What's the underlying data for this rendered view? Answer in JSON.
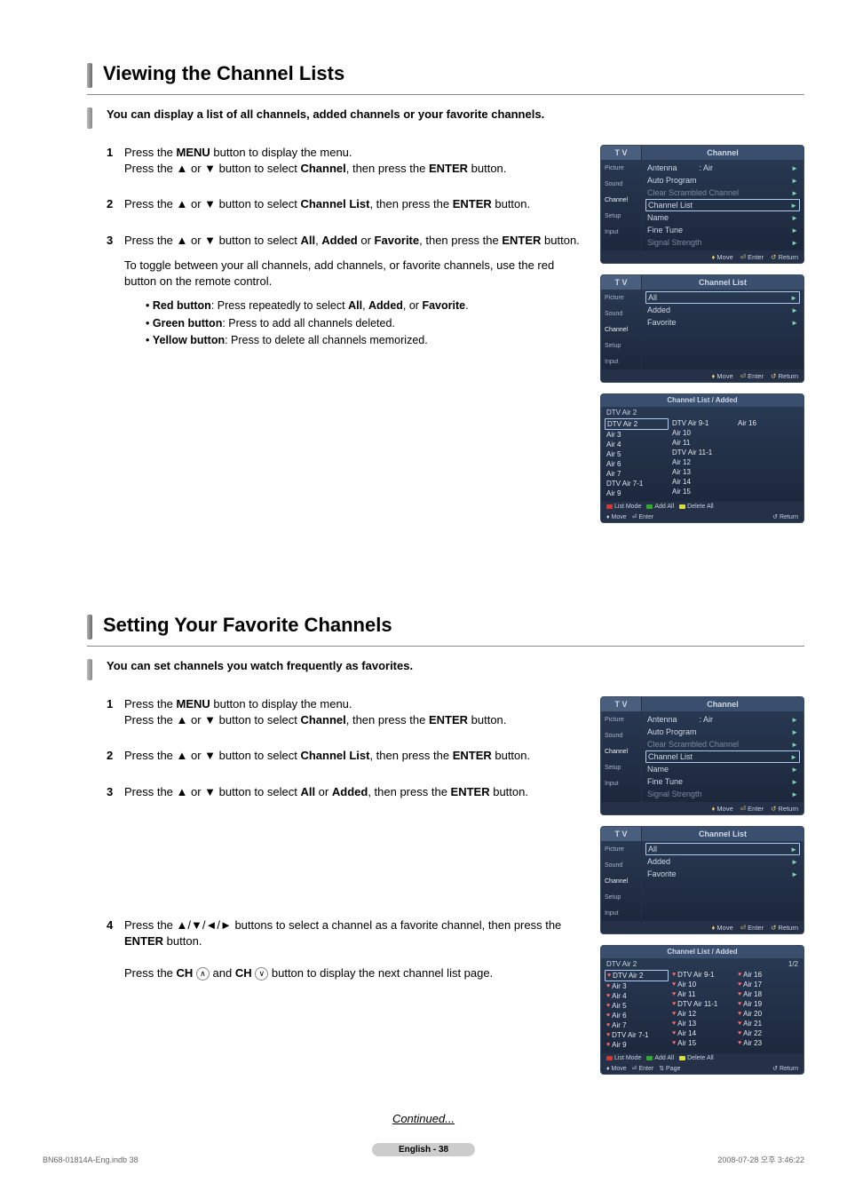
{
  "section1": {
    "title": "Viewing the Channel Lists",
    "intro": "You can display a list of all channels, added channels or your favorite channels.",
    "steps": {
      "s1a": "Press the ",
      "s1b": "MENU",
      "s1c": " button to display the menu.",
      "s1d": "Press the ▲ or ▼ button to select ",
      "s1e": "Channel",
      "s1f": ", then press the ",
      "s1g": "ENTER",
      "s1h": " button.",
      "s2a": "Press the ▲ or ▼ button to select ",
      "s2b": "Channel List",
      "s2c": ", then press the ",
      "s2d": "ENTER",
      "s2e": " button.",
      "s3a": "Press the ▲ or ▼ button to select ",
      "s3b": "All",
      "s3c": ", ",
      "s3d": "Added",
      "s3e": " or ",
      "s3f": "Favorite",
      "s3g": ", then press the ",
      "s3h": "ENTER",
      "s3i": " button.",
      "s3j": "To toggle between your all channels, add channels, or favorite channels, use the red button on the remote control.",
      "b1a": "Red button",
      "b1b": ": Press repeatedly to select ",
      "b1c": "All",
      "b1d": ", ",
      "b1e": "Added",
      "b1f": ", or ",
      "b1g": "Favorite",
      "b1h": ".",
      "b2a": "Green button",
      "b2b": ": Press to add all channels deleted.",
      "b3a": "Yellow button",
      "b3b": ": Press to delete all channels memorized."
    }
  },
  "section2": {
    "title": "Setting Your Favorite Channels",
    "intro": "You can set channels you watch frequently as favorites.",
    "steps": {
      "s1a": "Press the ",
      "s1b": "MENU",
      "s1c": " button to display the menu.",
      "s1d": "Press the ▲ or ▼ button to select ",
      "s1e": "Channel",
      "s1f": ", then press the ",
      "s1g": "ENTER",
      "s1h": " button.",
      "s2a": "Press the ▲ or ▼ button to select ",
      "s2b": "Channel List",
      "s2c": ", then press the ",
      "s2d": "ENTER",
      "s2e": " button.",
      "s3a": "Press the ▲ or ▼ button to select ",
      "s3b": "All",
      "s3c": " or ",
      "s3d": "Added",
      "s3e": ", then press the ",
      "s3f": "ENTER",
      "s3g": " button.",
      "s4a": "Press the ▲/▼/◄/► buttons to select a channel as a favorite channel, then press the ",
      "s4b": "ENTER",
      "s4c": " button.",
      "s4d": "Press the ",
      "s4e": "CH",
      "s4f": " and ",
      "s4g": "CH",
      "s4h": " button to display the next channel list page."
    }
  },
  "osd": {
    "tv": "T V",
    "channel_hd": "Channel",
    "chlist_hd": "Channel List",
    "side": {
      "picture": "Picture",
      "sound": "Sound",
      "channel": "Channel",
      "setup": "Setup",
      "input": "Input"
    },
    "menu": {
      "antenna": "Antenna",
      "antenna_val": ": Air",
      "auto": "Auto Program",
      "clear": "Clear Scrambled Channel",
      "chlist": "Channel List",
      "name": "Name",
      "fine": "Fine Tune",
      "signal": "Signal Strength"
    },
    "chlist_menu": {
      "all": "All",
      "added": "Added",
      "fav": "Favorite"
    },
    "foot": {
      "move": "Move",
      "enter": "Enter",
      "return": "Return",
      "page": "Page"
    },
    "listfoot": {
      "mode": "List Mode",
      "addall": "Add All",
      "delall": "Delete All"
    },
    "listhead": "Channel List / Added",
    "listsub": "DTV Air 2",
    "pager": "1/2",
    "ch1": {
      "col1": [
        "DTV Air 2",
        "Air 3",
        "Air 4",
        "Air 5",
        "Air 6",
        "Air 7",
        "DTV Air 7-1",
        "Air 9"
      ],
      "col2": [
        "DTV Air 9-1",
        "Air 10",
        "Air 11",
        "DTV Air 11-1",
        "Air 12",
        "Air 13",
        "Air 14",
        "Air 15"
      ],
      "col3": [
        "Air 16",
        "",
        "",
        "",
        "",
        "",
        "",
        ""
      ]
    },
    "ch2": {
      "col1": [
        "DTV Air 2",
        "Air 3",
        "Air 4",
        "Air 5",
        "Air 6",
        "Air 7",
        "DTV Air 7-1",
        "Air 9"
      ],
      "col2": [
        "DTV Air 9-1",
        "Air 10",
        "Air 11",
        "DTV Air 11-1",
        "Air 12",
        "Air 13",
        "Air 14",
        "Air 15"
      ],
      "col3": [
        "Air 16",
        "Air 17",
        "Air 18",
        "Air 19",
        "Air 20",
        "Air 21",
        "Air 22",
        "Air 23"
      ]
    }
  },
  "continued": "Continued...",
  "pagenum": "English - 38",
  "bottomleft": "BN68-01814A-Eng.indb   38",
  "bottomright": "2008-07-28   오후 3:46:22"
}
